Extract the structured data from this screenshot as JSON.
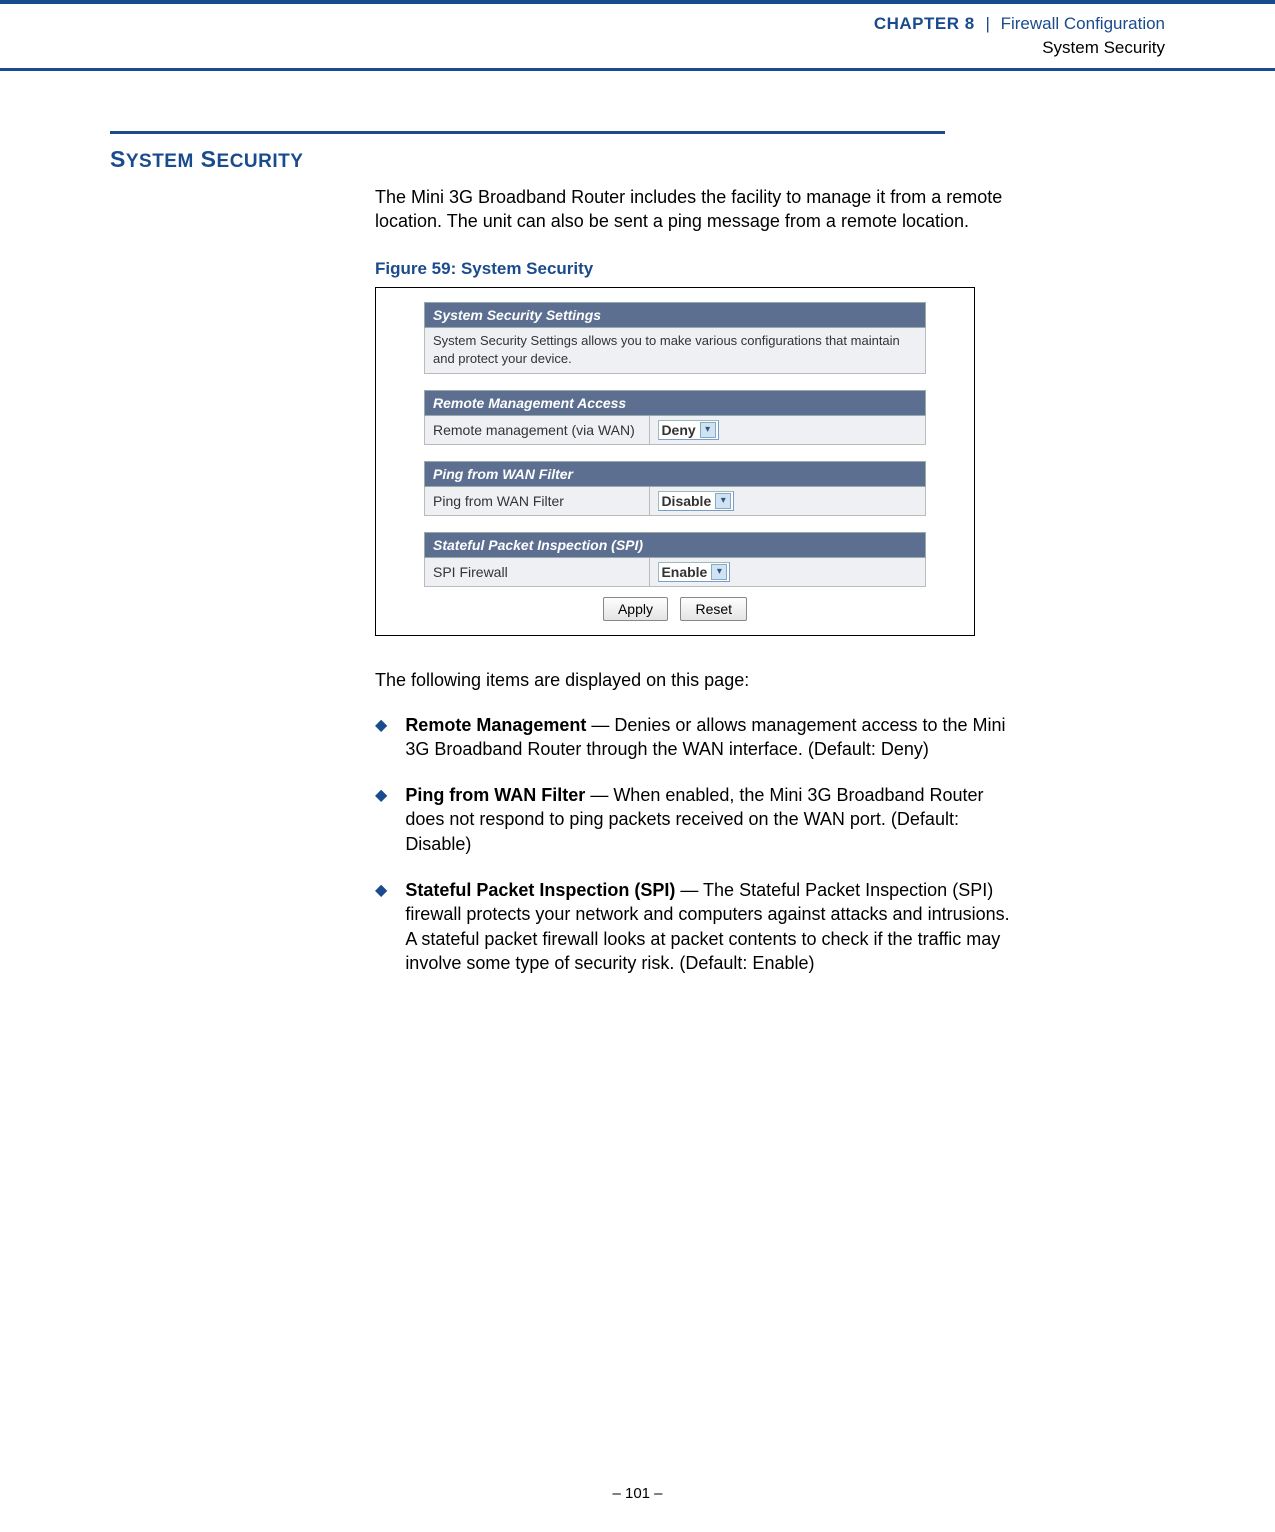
{
  "header": {
    "chapter": "CHAPTER 8",
    "sep": "|",
    "title": "Firewall Configuration",
    "subtitle": "System Security"
  },
  "section": {
    "heading": "SYSTEM SECURITY",
    "intro": "The Mini 3G Broadband Router includes the facility to manage it from a remote location. The unit can also be sent a ping message from a remote location."
  },
  "figure": {
    "caption": "Figure 59:  System Security",
    "panels": {
      "sys": {
        "header": "System Security Settings",
        "desc": "System Security Settings allows you to make various configurations that maintain and protect your device."
      },
      "remote": {
        "header": "Remote Management Access",
        "label": "Remote management (via WAN)",
        "value": "Deny"
      },
      "ping": {
        "header": "Ping from WAN Filter",
        "label": "Ping from WAN Filter",
        "value": "Disable"
      },
      "spi": {
        "header": "Stateful Packet Inspection (SPI)",
        "label": "SPI Firewall",
        "value": "Enable"
      }
    },
    "buttons": {
      "apply": "Apply",
      "reset": "Reset"
    }
  },
  "follow": "The following items are displayed on this page:",
  "bullets": [
    {
      "title": "Remote Management",
      "text": " — Denies or allows management access to the Mini 3G Broadband Router through the WAN interface. (Default: Deny)"
    },
    {
      "title": "Ping from WAN Filter",
      "text": " — When enabled, the Mini 3G Broadband Router does not respond to ping packets received on the WAN port. (Default: Disable)"
    },
    {
      "title": "Stateful Packet Inspection (SPI)",
      "text": " — The Stateful Packet Inspection (SPI) firewall protects your network and computers against attacks and intrusions. A stateful packet firewall looks at packet contents to check if the traffic may involve some type of security risk. (Default: Enable)"
    }
  ],
  "footer": {
    "page": "–  101  –"
  }
}
